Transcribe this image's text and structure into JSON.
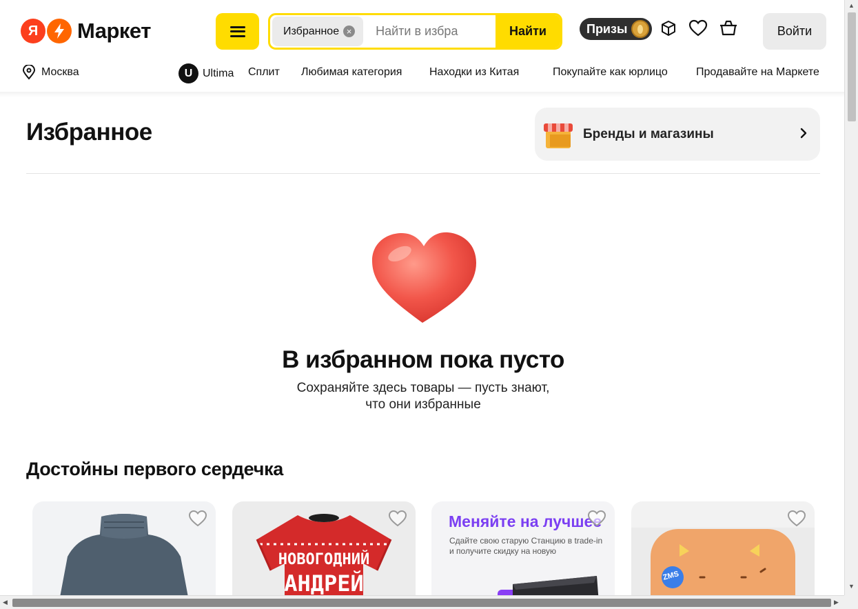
{
  "header": {
    "logo_text": "Маркет",
    "logo_ya": "Я",
    "search_chip": "Избранное",
    "search_placeholder": "Найти в избра",
    "search_button": "Найти",
    "prizes": "Призы",
    "login_button": "Войти"
  },
  "subnav": {
    "city": "Москва",
    "items": [
      "Ultima",
      "Сплит",
      "Любимая категория",
      "Находки из Китая",
      "Покупайте как юрлицо",
      "Продавайте на Маркете"
    ],
    "ultima_badge": "U"
  },
  "main": {
    "title": "Избранное",
    "brands_link": "Бренды и магазины",
    "empty_title": "В избранном пока пусто",
    "empty_subtitle_lines": [
      "Сохраняйте здесь товары — пусть знают,",
      "что они избранные"
    ],
    "section_title": "Достойны первого сердечка"
  },
  "cards": [
    {
      "product": "turtleneck",
      "bg": "#f2f3f5"
    },
    {
      "product": "t-shirt",
      "bg": "#ececec",
      "print_lines": [
        "НОВОГОДНИЙ",
        "АНДРЕЙ"
      ]
    },
    {
      "product": "station-trade-in",
      "bg": "#f4f4f6",
      "headline": "Меняйте на лучшее",
      "text_lines": [
        "Сдайте свою старую Станцию в trade-in",
        "и получите скидку на новую"
      ]
    },
    {
      "product": "smart-speaker",
      "bg": "#f2f2f2",
      "sticker": "ZMS"
    }
  ],
  "colors": {
    "accent_yellow": "#ffdc00",
    "logo_red": "#fc3f1d",
    "logo_orange": "#ff6600"
  }
}
